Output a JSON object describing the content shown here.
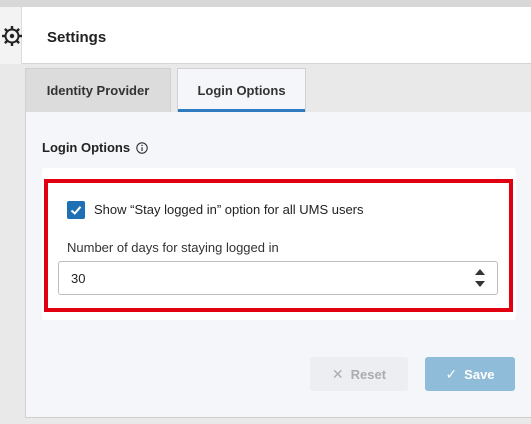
{
  "header": {
    "title": "Settings",
    "icon": "settings-gear-icon"
  },
  "tabs": [
    {
      "label": "Identity Provider",
      "active": false
    },
    {
      "label": "Login Options",
      "active": true
    }
  ],
  "login_options": {
    "section_title": "Login Options",
    "info_icon": "info-icon",
    "stay_logged_in": {
      "checked": true,
      "label": "Show “Stay logged in” option for all UMS users"
    },
    "days_field": {
      "label": "Number of days for staying logged in",
      "value": "30"
    }
  },
  "actions": {
    "reset_label": "Reset",
    "reset_icon": "close-icon",
    "save_label": "Save",
    "save_icon": "check-icon"
  },
  "colors": {
    "accent": "#1f6fb4",
    "tab_underline": "#2e7bbf",
    "highlight_border": "#e0000f",
    "save_button": "#8fbcd8"
  }
}
